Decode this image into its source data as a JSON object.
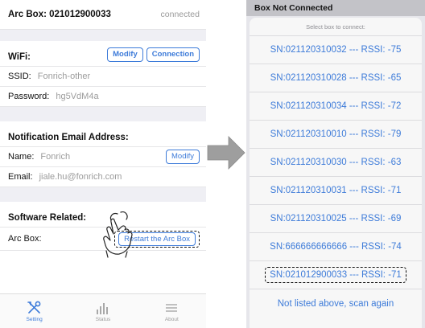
{
  "left_screen": {
    "header": {
      "title": "Arc Box: 021012900033",
      "status": "connected"
    },
    "wifi": {
      "section_label": "WiFi:",
      "modify_label": "Modify",
      "connection_label": "Connection",
      "ssid_label": "SSID:",
      "ssid_value": "Fonrich-other",
      "password_label": "Password:",
      "password_value": "hg5VdM4a"
    },
    "notification": {
      "section_label": "Notification Email Address:",
      "name_label": "Name:",
      "name_value": "Fonrich",
      "modify_label": "Modify",
      "email_label": "Email:",
      "email_value": "jiale.hu@fonrich.com"
    },
    "software": {
      "section_label": "Software Related:",
      "arc_box_label": "Arc Box:",
      "restart_label": "Restart the Arc Box"
    },
    "tabbar": {
      "tabs": [
        {
          "label": "Setting",
          "icon": "tools-icon",
          "active": true
        },
        {
          "label": "Status",
          "icon": "bar-chart-icon",
          "active": false
        },
        {
          "label": "About",
          "icon": "menu-icon",
          "active": false
        }
      ]
    }
  },
  "right_screen": {
    "header": {
      "title": "Box Not Connected"
    },
    "sheet": {
      "title": "Select box to connect:",
      "options": [
        "SN:021120310032 --- RSSI: -75",
        "SN:021120310028 --- RSSI: -65",
        "SN:021120310034 --- RSSI: -72",
        "SN:021120310010 --- RSSI: -79",
        "SN:021120310030 --- RSSI: -63",
        "SN:021120310031 --- RSSI: -71",
        "SN:021120310025 --- RSSI: -69",
        "SN:666666666666 --- RSSI: -74",
        "SN:021012900033 --- RSSI: -71"
      ],
      "scan_label": "Not listed above, scan again"
    }
  },
  "colors": {
    "accent": "#3d7bd9",
    "group_bg": "#efeff4",
    "arrow": "#9e9e9e"
  }
}
